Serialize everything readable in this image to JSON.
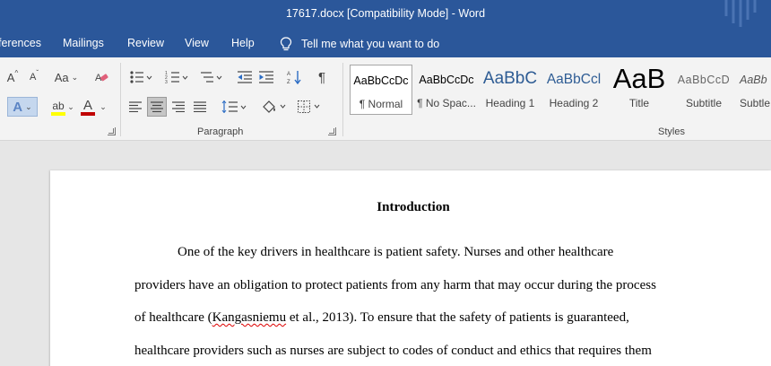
{
  "window": {
    "title": "17617.docx [Compatibility Mode]  -  Word"
  },
  "tabs": [
    {
      "label": "ferences"
    },
    {
      "label": "Mailings"
    },
    {
      "label": "Review"
    },
    {
      "label": "View"
    },
    {
      "label": "Help"
    }
  ],
  "tell_me": {
    "label": "Tell me what you want to do",
    "icon": "lightbulb-icon"
  },
  "ribbon": {
    "font_buttons": {
      "grow": "A",
      "shrink": "A",
      "change_case": "Aa",
      "highlight": "ab",
      "font_color": "A",
      "text_effects": "A"
    },
    "groups": [
      {
        "label": "Paragraph"
      },
      {
        "label": "Styles"
      }
    ],
    "styles": [
      {
        "sample": "AaBbCcDc",
        "name": "¶ Normal"
      },
      {
        "sample": "AaBbCcDc",
        "name": "¶ No Spac..."
      },
      {
        "sample": "AaBbC",
        "name": "Heading 1"
      },
      {
        "sample": "AaBbCcl",
        "name": "Heading 2"
      },
      {
        "sample": "AaB",
        "name": "Title"
      },
      {
        "sample": "AaBbCcD",
        "name": "Subtitle"
      },
      {
        "sample": "AaBb",
        "name": "Subtle"
      }
    ],
    "colors": {
      "highlight": "#ffff00",
      "font_color": "#c00000",
      "accent": "#2b579a"
    }
  },
  "document": {
    "heading": "Introduction",
    "lines": [
      "One of the key drivers in healthcare is patient safety. Nurses and other healthcare",
      "providers have an obligation to protect patients from any harm that may occur during the process",
      {
        "before": "of healthcare (",
        "misspelled": "Kangasniemu",
        "after": " et al., 2013). To ensure that the safety of patients is guaranteed,"
      },
      "healthcare providers such as nurses are subject to codes of conduct and ethics that requires them"
    ]
  }
}
